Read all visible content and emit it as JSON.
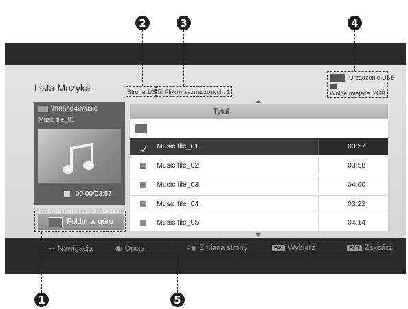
{
  "callouts": [
    "1",
    "2",
    "3",
    "4",
    "5"
  ],
  "list_title": "Lista Muzyka",
  "page_info": "Strona 1/3",
  "selected_info": "☑ Plików zaznaczonych: 1",
  "usb": {
    "device_label": "Urządzenie USB",
    "free_label": "Wolne miejsce",
    "free_value": "2GB",
    "usage_fraction": 0.13
  },
  "preview": {
    "path": "\\mnt\\hd4\\Music",
    "file": "Music file_01",
    "time": "00:00/03:57"
  },
  "folder_up_label": "Folder w górę",
  "list": {
    "header": "Tytuł",
    "rows": [
      {
        "name": "Music file_01",
        "duration": "03:57",
        "selected": true
      },
      {
        "name": "Music file_02",
        "duration": "03:58",
        "selected": false
      },
      {
        "name": "Music file_03",
        "duration": "04:00",
        "selected": false
      },
      {
        "name": "Music file_04",
        "duration": "03:22",
        "selected": false
      },
      {
        "name": "Music file_05",
        "duration": "04:14",
        "selected": false
      }
    ]
  },
  "nav": {
    "navigation": "Nawigacja",
    "option": "Opcja",
    "page_change": "Zmiana strony",
    "fav_key": "FAV",
    "select": "Wybierz",
    "exit_key": "EXIT",
    "close": "Zakończ"
  }
}
